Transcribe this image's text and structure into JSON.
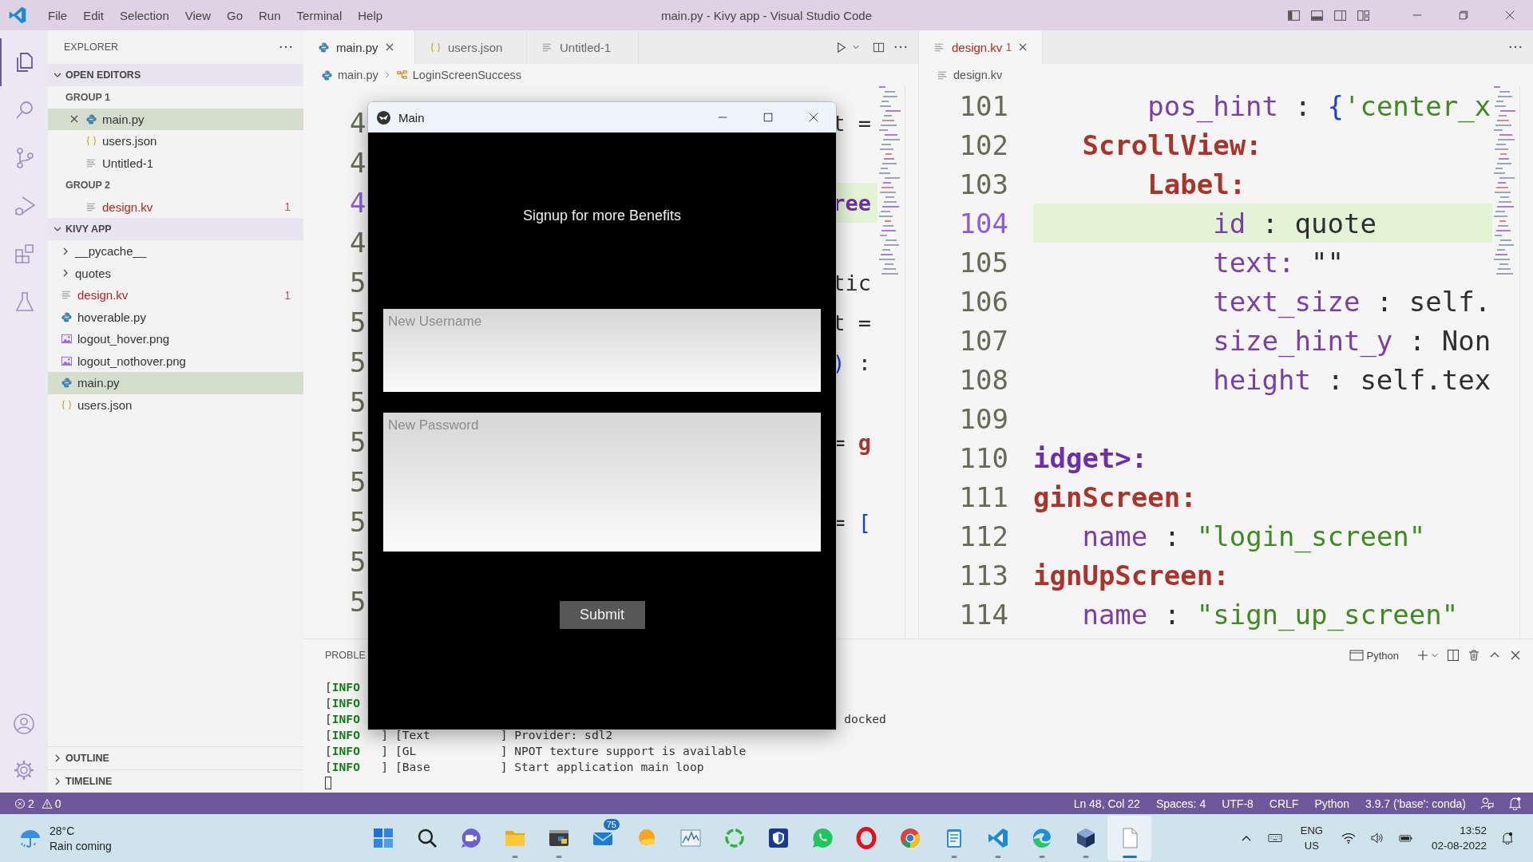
{
  "titlebar": {
    "menu": [
      "File",
      "Edit",
      "Selection",
      "View",
      "Go",
      "Run",
      "Terminal",
      "Help"
    ],
    "title": "main.py - Kivy app - Visual Studio Code"
  },
  "activity_bar": [
    {
      "selected": true
    },
    {
      "selected": false
    },
    {
      "selected": false
    },
    {
      "selected": false
    },
    {
      "selected": false
    },
    {
      "selected": false
    }
  ],
  "sidebar": {
    "title": "EXPLORER",
    "open_editors": {
      "title": "OPEN EDITORS",
      "expanded": true,
      "groups": [
        {
          "title": "GROUP 1",
          "items": [
            {
              "name": "main.py",
              "kind": "python",
              "selected": true
            },
            {
              "name": "users.json",
              "kind": "json",
              "selected": false
            },
            {
              "name": "Untitled-1",
              "kind": "text",
              "selected": false
            }
          ]
        },
        {
          "title": "GROUP 2",
          "items": [
            {
              "name": "design.kv",
              "kind": "text",
              "selected": false,
              "error": true,
              "count": "1"
            }
          ]
        }
      ]
    },
    "folder": {
      "title": "KIVY APP",
      "expanded": true,
      "items": [
        {
          "name": "__pycache__",
          "kind": "folder",
          "expanded": false,
          "selected": false
        },
        {
          "name": "quotes",
          "kind": "folder",
          "expanded": false,
          "selected": false
        },
        {
          "name": "design.kv",
          "kind": "text",
          "selected": false,
          "error": true,
          "count": "1"
        },
        {
          "name": "hoverable.py",
          "kind": "python",
          "selected": false
        },
        {
          "name": "logout_hover.png",
          "kind": "image",
          "selected": false
        },
        {
          "name": "logout_nothover.png",
          "kind": "image",
          "selected": false
        },
        {
          "name": "main.py",
          "kind": "python",
          "selected": true
        },
        {
          "name": "users.json",
          "kind": "json",
          "selected": false
        }
      ]
    },
    "collapsed_sections": [
      {
        "title": "OUTLINE",
        "expanded": false
      },
      {
        "title": "TIMELINE",
        "expanded": false
      }
    ]
  },
  "editors": [
    {
      "tabs": [
        {
          "name": "main.py",
          "kind": "python",
          "selected": true
        },
        {
          "name": "users.json",
          "kind": "json",
          "selected": false
        },
        {
          "name": "Untitled-1",
          "kind": "text",
          "selected": false
        }
      ],
      "breadcrumb": [
        {
          "text": "main.py",
          "kind": "python"
        },
        {
          "text": "LoginScreenSuccess",
          "kind": "symbol"
        }
      ],
      "lines": [
        {
          "number": "4",
          "current": false,
          "kind": "tail",
          "tokens": [
            {
              "text": "t =",
              "kind": "plain"
            }
          ]
        },
        {
          "number": "4",
          "current": false
        },
        {
          "number": "4",
          "current": true,
          "kind": "tail",
          "tokens": [
            {
              "text": "ree",
              "kind": "tag"
            }
          ]
        },
        {
          "number": "4",
          "current": false
        },
        {
          "number": "5",
          "current": false,
          "kind": "tail",
          "tokens": [
            {
              "text": "tic",
              "kind": "plain"
            }
          ]
        },
        {
          "number": "5",
          "current": false,
          "kind": "tail",
          "tokens": [
            {
              "text": "t =",
              "kind": "plain"
            }
          ]
        },
        {
          "number": "5",
          "current": false,
          "kind": "tail",
          "tokens": [
            {
              "text": ")",
              "kind": "brace"
            },
            {
              "text": " :",
              "kind": "plain"
            }
          ]
        },
        {
          "number": "5",
          "current": false
        },
        {
          "number": "5",
          "current": false,
          "kind": "tail",
          "tokens": [
            {
              "text": "= ",
              "kind": "plain"
            },
            {
              "text": "g",
              "kind": "red"
            }
          ]
        },
        {
          "number": "5",
          "current": false
        },
        {
          "number": "5",
          "current": false,
          "kind": "tail",
          "tokens": [
            {
              "text": "= ",
              "kind": "plain"
            },
            {
              "text": "[",
              "kind": "brace"
            }
          ]
        },
        {
          "number": "5",
          "current": false
        },
        {
          "number": "5",
          "current": false
        }
      ]
    },
    {
      "tabs": [
        {
          "name": "design.kv",
          "kind": "text",
          "selected": true,
          "error": true,
          "count": "1"
        }
      ],
      "breadcrumb": [
        {
          "text": "design.kv",
          "kind": "text"
        }
      ],
      "lines": [
        {
          "number": "101",
          "kind": "full",
          "current": false,
          "tokens": [
            {
              "text": "       pos_hint",
              "kind": "prop"
            },
            {
              "text": " : ",
              "kind": "plain"
            },
            {
              "text": "{",
              "kind": "brace"
            },
            {
              "text": "'center_x",
              "kind": "string"
            }
          ]
        },
        {
          "number": "102",
          "kind": "full",
          "current": false,
          "tokens": [
            {
              "text": "   ScrollView:",
              "kind": "class"
            }
          ]
        },
        {
          "number": "103",
          "kind": "full",
          "current": false,
          "tokens": [
            {
              "text": "       Label:",
              "kind": "class"
            }
          ]
        },
        {
          "number": "104",
          "kind": "full",
          "current": true,
          "tokens": [
            {
              "text": "           id",
              "kind": "prop"
            },
            {
              "text": " : quote",
              "kind": "plain"
            }
          ]
        },
        {
          "number": "105",
          "kind": "full",
          "current": false,
          "tokens": [
            {
              "text": "           text:",
              "kind": "prop"
            },
            {
              "text": " \"\"",
              "kind": "plain"
            }
          ]
        },
        {
          "number": "106",
          "kind": "full",
          "current": false,
          "tokens": [
            {
              "text": "           text_size",
              "kind": "prop"
            },
            {
              "text": " : self.",
              "kind": "plain"
            }
          ]
        },
        {
          "number": "107",
          "kind": "full",
          "current": false,
          "tokens": [
            {
              "text": "           size_hint_y",
              "kind": "prop"
            },
            {
              "text": " : Non",
              "kind": "plain"
            }
          ]
        },
        {
          "number": "108",
          "kind": "full",
          "current": false,
          "tokens": [
            {
              "text": "           height",
              "kind": "prop"
            },
            {
              "text": " : self.tex",
              "kind": "plain"
            }
          ]
        },
        {
          "number": "109",
          "current": false
        },
        {
          "number": "110",
          "kind": "full",
          "current": false,
          "tokens": [
            {
              "text": "idget>:",
              "kind": "tag"
            }
          ]
        },
        {
          "number": "111",
          "kind": "full",
          "current": false,
          "tokens": [
            {
              "text": "ginScreen:",
              "kind": "class"
            }
          ]
        },
        {
          "number": "112",
          "kind": "full",
          "current": false,
          "tokens": [
            {
              "text": "   name",
              "kind": "prop"
            },
            {
              "text": " : ",
              "kind": "plain"
            },
            {
              "text": "\"login_screen\"",
              "kind": "string"
            }
          ]
        },
        {
          "number": "113",
          "kind": "full",
          "current": false,
          "tokens": [
            {
              "text": "ignUpScreen:",
              "kind": "class"
            }
          ]
        },
        {
          "number": "114",
          "kind": "full",
          "current": false,
          "tokens": [
            {
              "text": "   name",
              "kind": "prop"
            },
            {
              "text": " : ",
              "kind": "plain"
            },
            {
              "text": "\"sign_up_screen\"",
              "kind": "string"
            }
          ]
        }
      ]
    }
  ],
  "panel": {
    "tab": "PROBLE",
    "terminal": "Python",
    "lines": [
      {
        "open": "[",
        "tag": "INFO"
      },
      {
        "open": "[",
        "tag": "INFO"
      },
      {
        "open": "[",
        "tag": "INFO",
        "tail": "docked"
      },
      {
        "open": "[",
        "tag": "INFO",
        "text": "   ] [Text          ] Provider: sdl2"
      },
      {
        "open": "[",
        "tag": "INFO",
        "text": "   ] [GL            ] NPOT texture support is available"
      },
      {
        "open": "[",
        "tag": "INFO",
        "text": "   ] [Base          ] Start application main loop"
      }
    ]
  },
  "app_window": {
    "title": "Main",
    "heading": "Signup for more Benefits",
    "fields": [
      {
        "kind": "username",
        "placeholder": "New Username"
      },
      {
        "kind": "password",
        "placeholder": "New Password"
      }
    ],
    "button": "Submit"
  },
  "status_bar": {
    "errors": "2",
    "warnings": "0",
    "items": [
      "Ln 48, Col 22",
      "Spaces: 4",
      "UTF-8",
      "CRLF",
      "Python",
      "3.9.7 ('base': conda)"
    ]
  },
  "taskbar": {
    "weather": {
      "temperature": "28°C",
      "text": "Rain coming"
    },
    "apps": [
      {
        "running": false,
        "active": false
      },
      {
        "running": false,
        "active": false
      },
      {
        "running": false,
        "active": false
      },
      {
        "running": true,
        "active": false
      },
      {
        "running": true,
        "active": false
      },
      {
        "running": false,
        "active": false,
        "badge": "75"
      },
      {
        "running": false,
        "active": false
      },
      {
        "running": false,
        "active": false
      },
      {
        "running": false,
        "active": false
      },
      {
        "running": false,
        "active": false
      },
      {
        "running": false,
        "active": false
      },
      {
        "running": false,
        "active": false
      },
      {
        "running": false,
        "active": false
      },
      {
        "running": true,
        "active": false
      },
      {
        "running": true,
        "active": false
      },
      {
        "running": true,
        "active": false
      },
      {
        "running": true,
        "active": false
      },
      {
        "running": true,
        "active": true
      }
    ],
    "language": "ENG",
    "region": "US",
    "time": "13:52",
    "date": "02-08-2022"
  }
}
